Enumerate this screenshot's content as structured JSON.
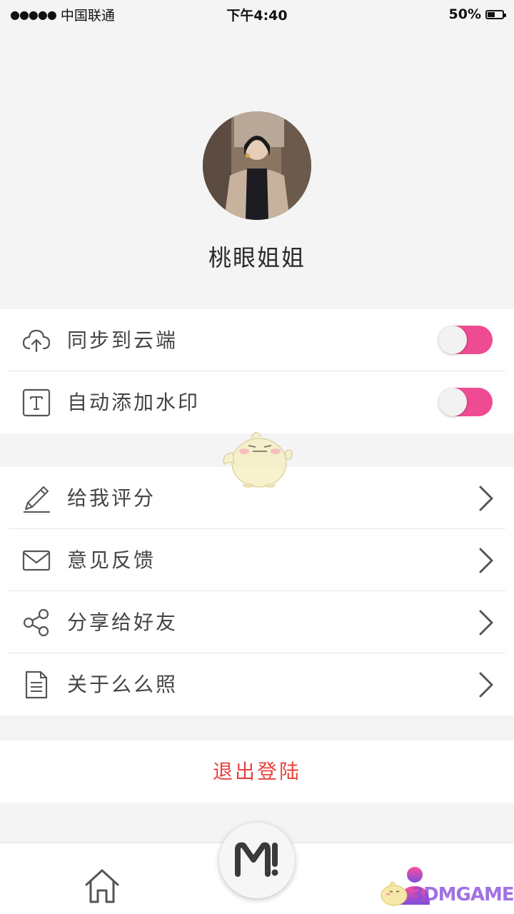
{
  "status_bar": {
    "signal": "●●●●●",
    "carrier": "中国联通",
    "time": "下午4:40",
    "battery": "50%",
    "battery_level": 0.5
  },
  "profile": {
    "username": "桃眼姐姐"
  },
  "toggles": [
    {
      "label": "同步到云端",
      "icon": "cloud-upload-icon",
      "on": true
    },
    {
      "label": "自动添加水印",
      "icon": "text-t-icon",
      "on": true
    }
  ],
  "menu": [
    {
      "label": "给我评分",
      "icon": "pencil-icon"
    },
    {
      "label": "意见反馈",
      "icon": "envelope-icon"
    },
    {
      "label": "分享给好友",
      "icon": "share-icon"
    },
    {
      "label": "关于么么照",
      "icon": "document-icon"
    }
  ],
  "logout_label": "退出登陆",
  "watermark": "3DMGAME",
  "colors": {
    "accent_pink": "#ee4b93",
    "logout_red": "#e8433f",
    "background": "#f4f4f4"
  }
}
